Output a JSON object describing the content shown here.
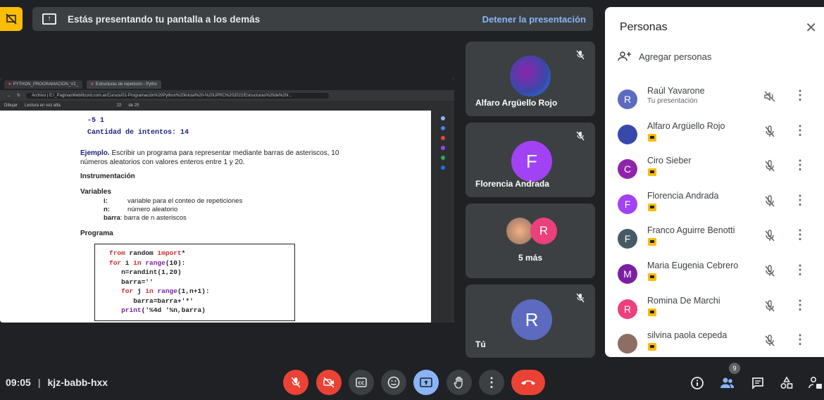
{
  "banner": {
    "text": "Estás presentando tu pantalla a los demás",
    "stop_label": "Detener la presentación"
  },
  "shared_screen": {
    "tabs": [
      "PYTHON_PROGRAMACION_V2_",
      "Estructuras de repetición - Pytho"
    ],
    "url_prefix": "Archivo",
    "url": "E:/_PaginasWeb/ltcord.com.ar/Cursos/01-Programación%20Python%20inicial%20-%20UPRC%202022/Estructuras%20de%20r...",
    "pdf_toolbar": {
      "draw": "Dibujar",
      "read_aloud": "Lectura en voz alta",
      "page": "22",
      "page_total": "de 25"
    },
    "doc": {
      "line1": "-5 1",
      "line2": "Cantidad de intentos:  14",
      "ejemplo_label": "Ejemplo.",
      "ejemplo_text": " Escribir un programa para representar mediante barras de asteriscos, 10",
      "ejemplo_text2": "números aleatorios con valores enteros entre 1 y 20.",
      "instrumentacion": "Instrumentación",
      "variables": "Variables",
      "vars": [
        {
          "name": "i:",
          "desc": "variable para el conteo de repeticiones"
        },
        {
          "name": "n:",
          "desc": "número aleatorio"
        },
        {
          "name": "barra",
          "desc": ": barra de n asteriscos"
        }
      ],
      "programa": "Programa"
    }
  },
  "tiles": [
    {
      "name": "Alfaro Argüello Rojo"
    },
    {
      "name": "Florencia Andrada",
      "initial": "F"
    },
    {
      "name": "5 más",
      "initial": "R"
    },
    {
      "name": "Tú",
      "initial": "R"
    }
  ],
  "panel": {
    "title": "Personas",
    "add_label": "Agregar personas",
    "people": [
      {
        "name": "Raúl Yavarone",
        "sub": "Tu presentación",
        "initial": "R",
        "color": "#5c6bc0"
      },
      {
        "name": "Alfaro Argüello Rojo",
        "initial": "",
        "color": "#3949ab"
      },
      {
        "name": "Ciro Sieber",
        "initial": "C",
        "color": "#8e24aa"
      },
      {
        "name": "Florencia Andrada",
        "initial": "F",
        "color": "#a142f4"
      },
      {
        "name": "Franco Aguirre Benotti",
        "initial": "F",
        "color": "#455a64"
      },
      {
        "name": "Maria Eugenia Cebrero",
        "initial": "M",
        "color": "#7b1fa2"
      },
      {
        "name": "Romina De Marchi",
        "initial": "R",
        "color": "#ec407a"
      },
      {
        "name": "silvina paola cepeda",
        "initial": "",
        "color": "#8d6e63"
      }
    ]
  },
  "bottom": {
    "time": "09:05",
    "meeting_code": "kjz-babb-hxx",
    "people_count": "9"
  }
}
